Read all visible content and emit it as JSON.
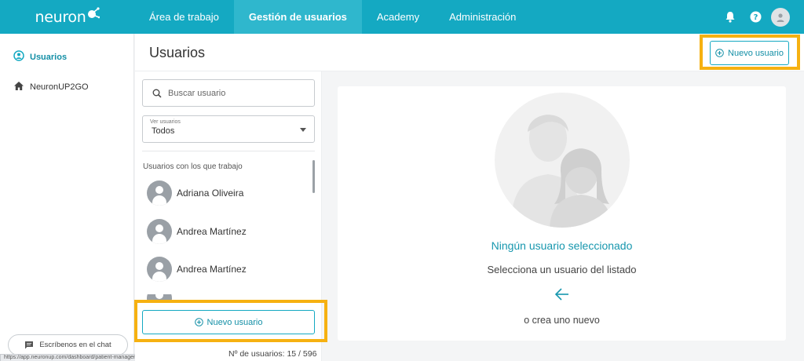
{
  "app": {
    "logo_text": "neuron",
    "logo_badge": "UP"
  },
  "nav": {
    "items": [
      {
        "label": "Área de trabajo"
      },
      {
        "label": "Gestión de usuarios"
      },
      {
        "label": "Academy"
      },
      {
        "label": "Administración"
      }
    ],
    "active_index": 1
  },
  "top_icons": [
    "bell-icon",
    "help-icon",
    "user-avatar"
  ],
  "sidebar": {
    "items": [
      {
        "label": "Usuarios",
        "icon": "user-circle-icon",
        "active": true
      },
      {
        "label": "NeuronUP2GO",
        "icon": "home-icon",
        "active": false
      }
    ],
    "chat_label": "Escríbenos en el chat",
    "status_url": "https://app.neuronup.com/dashboard/patient-management"
  },
  "page": {
    "title": "Usuarios",
    "new_user_label": "Nuevo usuario"
  },
  "list": {
    "search_placeholder": "Buscar usuario",
    "filter_label": "Ver usuarios",
    "filter_value": "Todos",
    "section_title": "Usuarios con los que trabajo",
    "users": [
      {
        "name": "Adriana Oliveira"
      },
      {
        "name": "Andrea Martínez"
      },
      {
        "name": "Andrea Martínez"
      }
    ],
    "new_user_label": "Nuevo usuario",
    "count_text": "Nº de usuarios: 15 / 596"
  },
  "detail": {
    "empty_title": "Ningún usuario seleccionado",
    "empty_subtitle": "Selecciona un usuario del listado",
    "empty_or": "o crea uno nuevo"
  },
  "colors": {
    "brand": "#14a9c2",
    "highlight": "#f6b111",
    "accent_text": "#1797ae"
  }
}
